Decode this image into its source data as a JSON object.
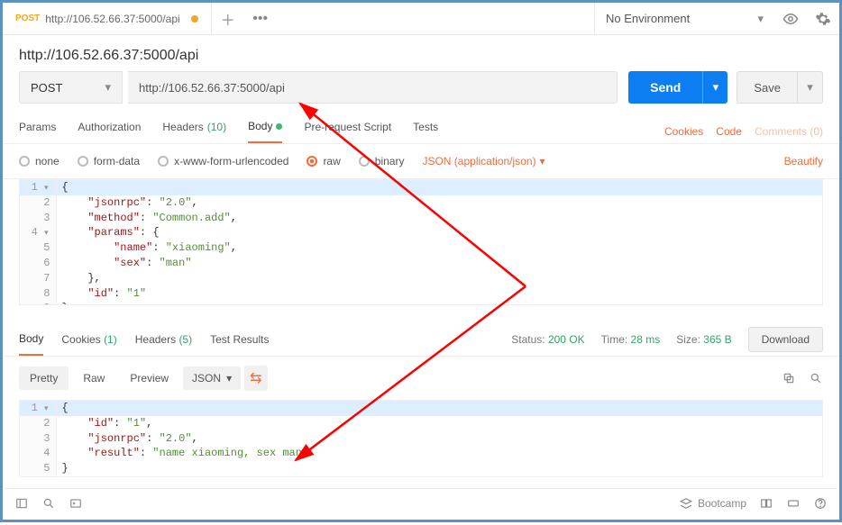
{
  "tab": {
    "method": "POST",
    "url": "http://106.52.66.37:5000/api"
  },
  "env": {
    "label": "No Environment"
  },
  "title": "http://106.52.66.37:5000/api",
  "request": {
    "method": "POST",
    "url": "http://106.52.66.37:5000/api",
    "send": "Send",
    "save": "Save"
  },
  "reqTabs": {
    "params": "Params",
    "auth": "Authorization",
    "headers": "Headers",
    "headersCount": "(10)",
    "body": "Body",
    "pre": "Pre-request Script",
    "tests": "Tests",
    "cookies": "Cookies",
    "code": "Code",
    "comments": "Comments (0)"
  },
  "bodyTypes": {
    "none": "none",
    "form": "form-data",
    "x": "x-www-form-urlencoded",
    "raw": "raw",
    "binary": "binary",
    "rawType": "JSON (application/json)",
    "beautify": "Beautify"
  },
  "reqCode": {
    "l1": "{",
    "l2a": "\"jsonrpc\"",
    "l2b": ": ",
    "l2c": "\"2.0\"",
    "l2d": ",",
    "l3a": "\"method\"",
    "l3b": ": ",
    "l3c": "\"Common.add\"",
    "l3d": ",",
    "l4a": "\"params\"",
    "l4b": ": {",
    "l5a": "\"name\"",
    "l5b": ": ",
    "l5c": "\"xiaoming\"",
    "l5d": ",",
    "l6a": "\"sex\"",
    "l6b": ": ",
    "l6c": "\"man\"",
    "l7": "},",
    "l8a": "\"id\"",
    "l8b": ": ",
    "l8c": "\"1\"",
    "l9": "}"
  },
  "respTabs": {
    "body": "Body",
    "cookies": "Cookies",
    "cookiesCount": "(1)",
    "headers": "Headers",
    "headersCount": "(5)",
    "tests": "Test Results"
  },
  "respMeta": {
    "statusLabel": "Status:",
    "statusValue": "200 OK",
    "timeLabel": "Time:",
    "timeValue": "28 ms",
    "sizeLabel": "Size:",
    "sizeValue": "365 B",
    "download": "Download"
  },
  "viewTabs": {
    "pretty": "Pretty",
    "raw": "Raw",
    "preview": "Preview",
    "json": "JSON"
  },
  "respCode": {
    "l1": "{",
    "l2a": "\"id\"",
    "l2b": ": ",
    "l2c": "\"1\"",
    "l2d": ",",
    "l3a": "\"jsonrpc\"",
    "l3b": ": ",
    "l3c": "\"2.0\"",
    "l3d": ",",
    "l4a": "\"result\"",
    "l4b": ": ",
    "l4c": "\"name xiaoming, sex man\"",
    "l5": "}"
  },
  "footer": {
    "bootcamp": "Bootcamp"
  }
}
